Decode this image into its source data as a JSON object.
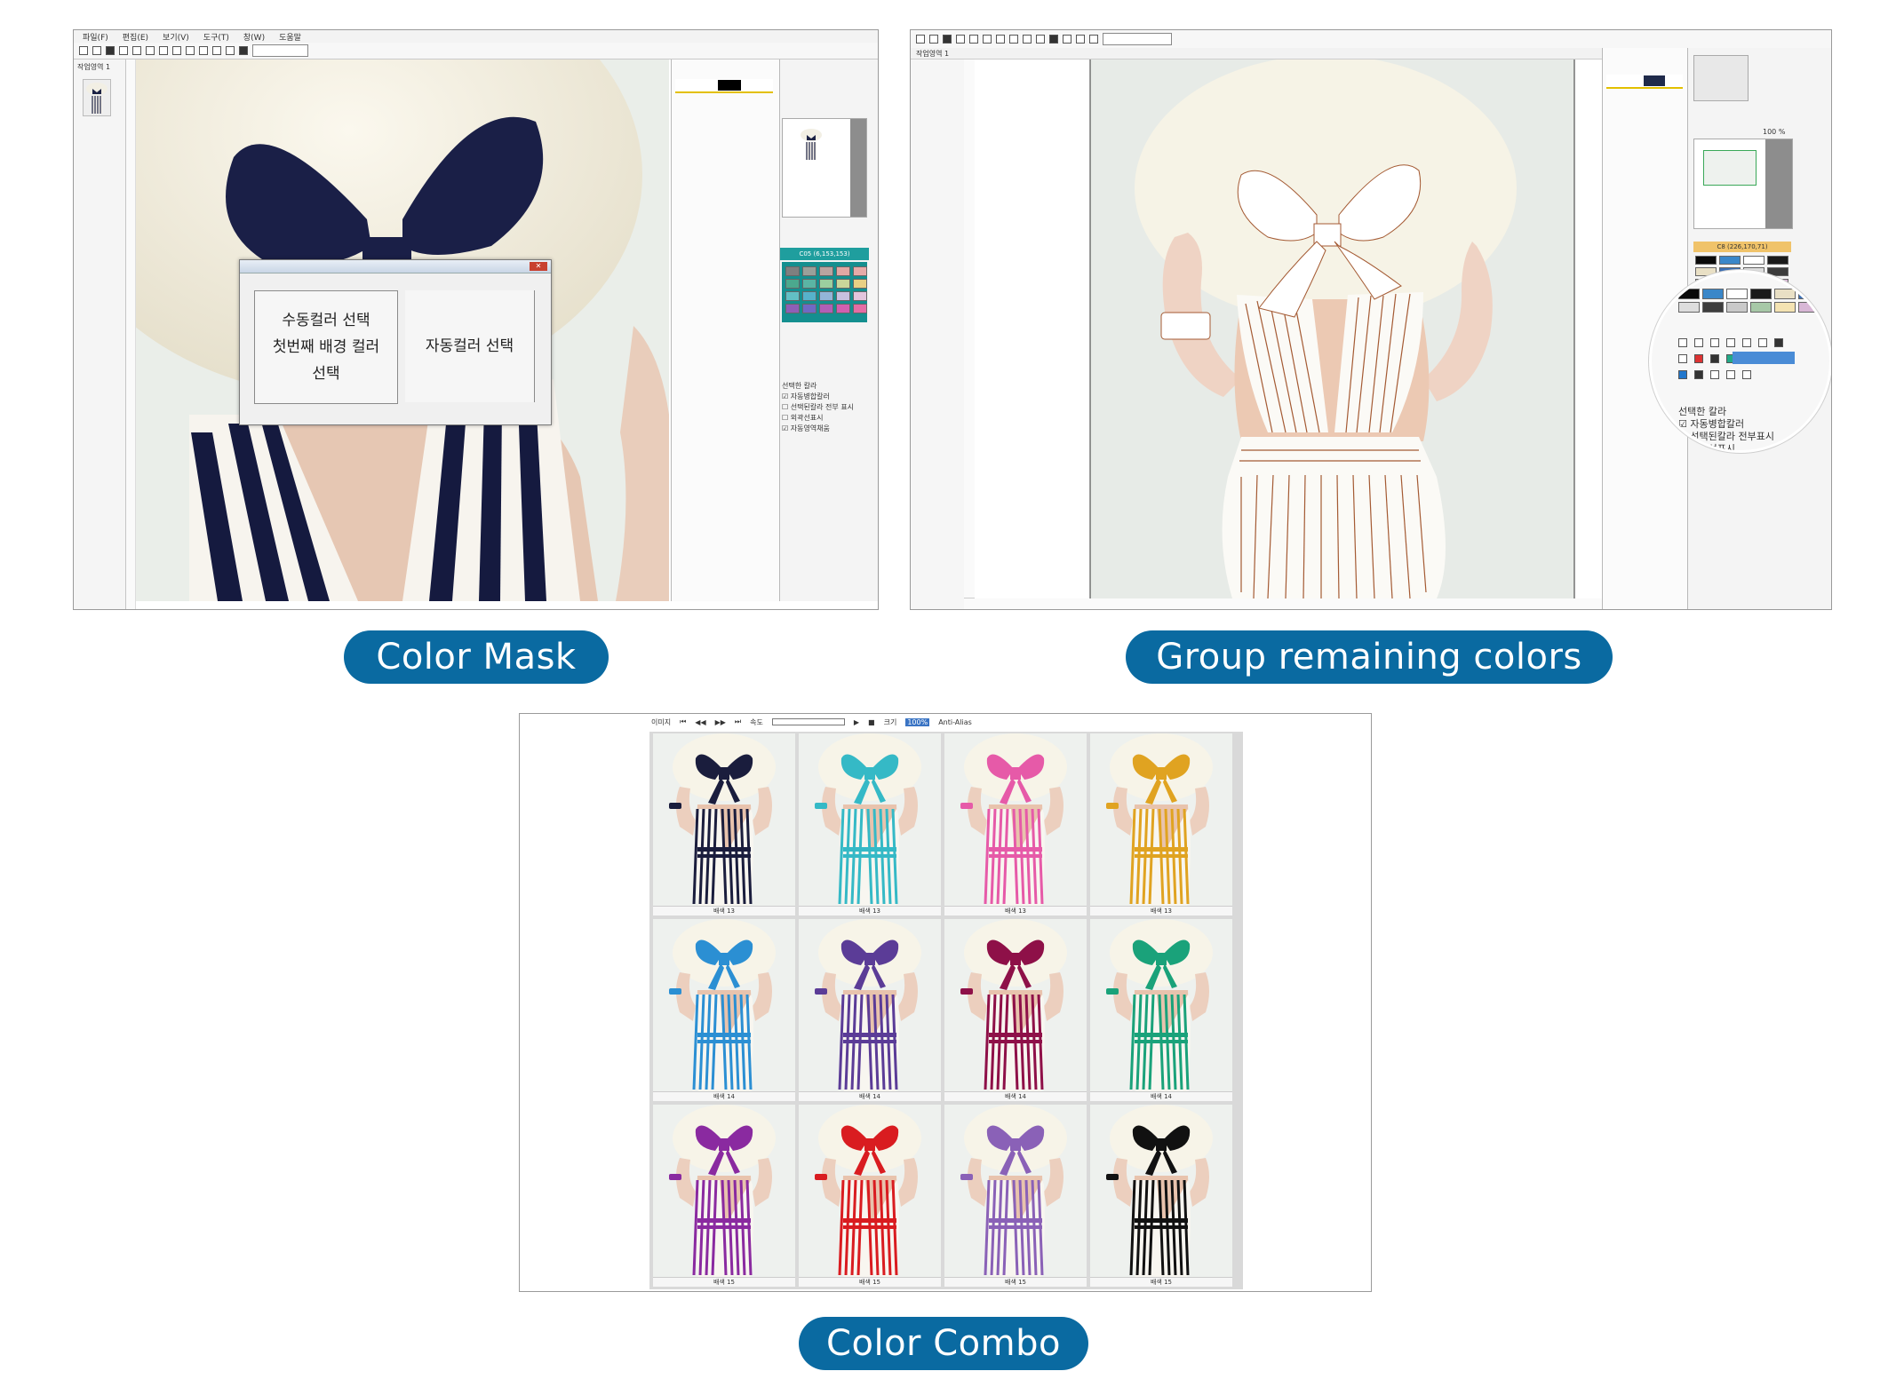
{
  "captions": {
    "color_mask": "Color Mask",
    "group_remaining": "Group remaining colors",
    "color_combo": "Color Combo"
  },
  "color_mask": {
    "menu": [
      "파일(F)",
      "편집(E)",
      "보기(V)",
      "도구(T)",
      "창(W)",
      "도움말"
    ],
    "tab": "작업영역 1",
    "color_readout": "C05 (6,153,153)",
    "options_title": "선택한 칼라",
    "options": [
      {
        "label": "자동병합칼러",
        "checked": true
      },
      {
        "label": "선택된칼라 전부 표시",
        "checked": false
      },
      {
        "label": "외곽선표시",
        "checked": false
      },
      {
        "label": "자동영역채움",
        "checked": true
      }
    ],
    "dialog": {
      "manual_button": "수동컬러 선택\n첫번째 배경 컬러\n선택",
      "auto_button": "자동컬러 선택"
    },
    "swatch_colors": [
      "#7f7f7f",
      "#9aa09a",
      "#b9a4a0",
      "#e2a7a3",
      "#e7aaa8",
      "#4ba98e",
      "#5ab5a4",
      "#9bcf9f",
      "#c9d59a",
      "#e8d084",
      "#62c0c5",
      "#56b2cb",
      "#93b5d8",
      "#c8c0df",
      "#e3c5dd",
      "#8e5fb7",
      "#6f6ac4",
      "#b15fb7",
      "#d15fb0",
      "#e46da5"
    ]
  },
  "group_remaining": {
    "tab": "작업영역 1",
    "zoom": "100 %",
    "color_readout": "C8 (226,170,71)",
    "options_title": "선택한 칼라",
    "options": [
      {
        "label": "자동병합칼러",
        "checked": true
      },
      {
        "label": "선택된칼라 전부표시",
        "checked": false
      },
      {
        "label": "외곽선표시",
        "checked": false
      }
    ],
    "swatch_colors": [
      "#0a0a0a",
      "#3a87c9",
      "#ffffff",
      "#1a1a1a",
      "#e9e0c5",
      "#3b6fb4",
      "#dddddd",
      "#3d3d3d",
      "#c9c9c9",
      "#a7c8a7",
      "#f4e3b2",
      "#d8b7d6"
    ]
  },
  "combo": {
    "toolbar": {
      "label_a": "이미지",
      "label_b": "속도",
      "label_c": "크기",
      "size_value": "100%",
      "antialias": "Anti-Alias"
    },
    "tiles": [
      {
        "color": "#1a1d3d",
        "caption": "배색 13"
      },
      {
        "color": "#35b9c6",
        "caption": "배색 13"
      },
      {
        "color": "#e65aa8",
        "caption": "배색 13"
      },
      {
        "color": "#e0a321",
        "caption": "배색 13"
      },
      {
        "color": "#2b8fd3",
        "caption": "배색 14"
      },
      {
        "color": "#5b3c97",
        "caption": "배색 14"
      },
      {
        "color": "#8e1048",
        "caption": "배색 14"
      },
      {
        "color": "#1aa27a",
        "caption": "배색 14"
      },
      {
        "color": "#8a2aa0",
        "caption": "배색 15"
      },
      {
        "color": "#d91c20",
        "caption": "배색 15"
      },
      {
        "color": "#8a61b7",
        "caption": "배색 15"
      },
      {
        "color": "#111111",
        "caption": "배색 15"
      }
    ]
  }
}
